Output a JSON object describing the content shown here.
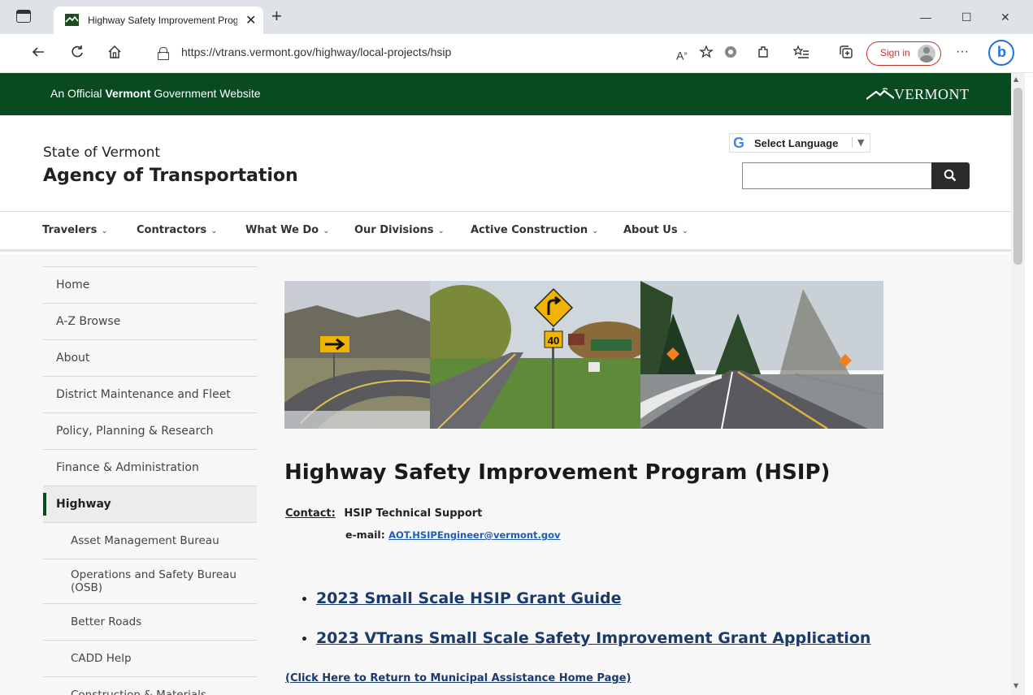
{
  "browser": {
    "tab_title": "Highway Safety Improvement Program (HSIP) - Agency of Transportation",
    "tab_close": "✕",
    "new_tab": "+",
    "url": "https://vtrans.vermont.gov/highway/local-projects/hsip",
    "sign_in": "Sign in",
    "more": "···",
    "minimize": "—",
    "maximize": "☐",
    "close": "✕",
    "icons": [
      "back-icon",
      "refresh-icon",
      "home-icon",
      "lock-icon",
      "read-aloud-icon",
      "favorite-icon",
      "extensions-icon",
      "favorites-list-icon",
      "collections-icon",
      "bing-icon"
    ]
  },
  "gov_banner": {
    "prefix": "An Official ",
    "bold": "Vermont",
    "suffix": " Government Website",
    "logo_text": "VERMONT"
  },
  "header": {
    "state": "State of Vermont",
    "agency": "Agency of Transportation",
    "language_label": "Select Language",
    "language_arrow": "▼",
    "search_placeholder": ""
  },
  "nav": {
    "items": [
      {
        "label": "Travelers"
      },
      {
        "label": "Contractors"
      },
      {
        "label": "What We Do"
      },
      {
        "label": "Our Divisions"
      },
      {
        "label": "Active Construction"
      },
      {
        "label": "About Us"
      }
    ],
    "chevron": "⌄"
  },
  "sidebar": {
    "items": [
      {
        "label": "Home"
      },
      {
        "label": "A-Z Browse"
      },
      {
        "label": "About"
      },
      {
        "label": "District Maintenance and Fleet"
      },
      {
        "label": "Policy, Planning & Research"
      },
      {
        "label": "Finance & Administration"
      },
      {
        "label": "Highway"
      },
      {
        "label": "Asset Management Bureau"
      },
      {
        "label": "Operations and Safety Bureau (OSB)"
      },
      {
        "label": "Better Roads"
      },
      {
        "label": "CADD Help"
      },
      {
        "label": "Construction & Materials"
      }
    ]
  },
  "main": {
    "title": "Highway Safety Improvement Program (HSIP)",
    "contact_label": "Contact:",
    "contact_value": "HSIP Technical Support",
    "email_label": "e-mail:",
    "email": "AOT.HSIPEngineer@vermont.gov",
    "bullet": "•",
    "links": [
      {
        "label": "2023 Small Scale HSIP Grant Guide"
      },
      {
        "label": "2023 VTrans Small Scale Safety Improvement Grant Application"
      }
    ],
    "return_link": "(Click Here to Return to Municipal Assistance Home Page)",
    "hero_sign_speed": "40"
  },
  "colors": {
    "gov_green": "#0a4a21",
    "link_blue": "#1a3a6b",
    "email_blue": "#1e5db8",
    "signin_red": "#c0392b"
  }
}
